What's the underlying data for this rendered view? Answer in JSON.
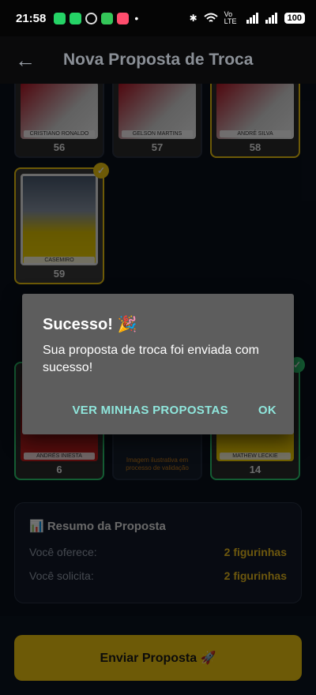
{
  "status_bar": {
    "time": "21:58",
    "notifications": [
      "whatsapp-icon",
      "whatsapp-icon",
      "app-icon",
      "shield-icon",
      "calendar-icon"
    ],
    "dot": "•",
    "network": "Vo LTE",
    "battery": "100"
  },
  "app_bar": {
    "back_icon": "←",
    "title": "Nova Proposta de Troca"
  },
  "offered": {
    "cards": [
      {
        "name": "CRISTIANO RONALDO",
        "number": "56"
      },
      {
        "name": "GELSON MARTINS",
        "number": "57"
      },
      {
        "name": "ANDRÉ SILVA",
        "number": "58"
      },
      {
        "name": "CASEMIRO",
        "number": "59"
      }
    ]
  },
  "requested": {
    "cards": [
      {
        "name": "ANDRÉS INIESTA",
        "number": "6"
      },
      {
        "placeholder": "Imagem ilustrativa em processo de validação"
      },
      {
        "name": "MATHEW LECKIE",
        "number": "14"
      }
    ]
  },
  "summary": {
    "title": "📊 Resumo da Proposta",
    "offer_label": "Você oferece:",
    "offer_value": "2 figurinhas",
    "request_label": "Você solicita:",
    "request_value": "2 figurinhas"
  },
  "send_button": {
    "label": "Enviar Proposta 🚀"
  },
  "dialog": {
    "title": "Sucesso! 🎉",
    "message": "Sua proposta de troca foi enviada com sucesso!",
    "action_secondary": "VER MINHAS PROPOSTAS",
    "action_primary": "OK"
  },
  "colors": {
    "accent_yellow": "#f2c811",
    "accent_green": "#2ecc71",
    "dialog_action": "#8fe6dc"
  }
}
